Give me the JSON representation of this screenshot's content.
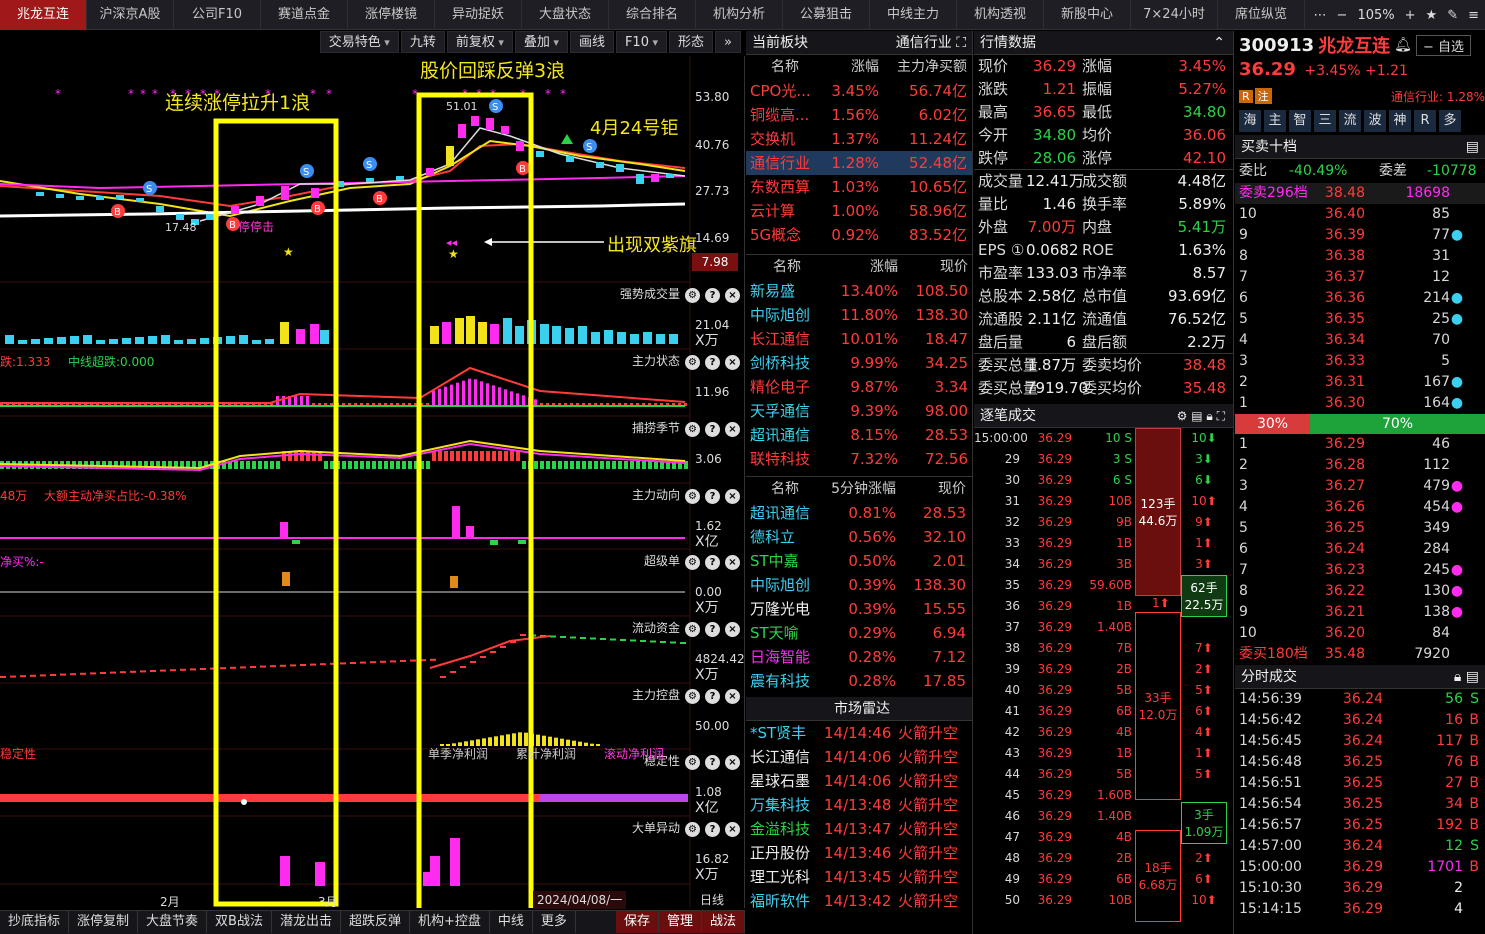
{
  "tabs": [
    "兆龙互连",
    "沪深京A股",
    "公司F10",
    "赛道点金",
    "涨停楼镜",
    "异动捉妖",
    "大盘状态",
    "综合排名",
    "机构分析",
    "公募狙击",
    "中线主力",
    "机构透视",
    "新股中心",
    "7×24小时",
    "席位纵览"
  ],
  "tab_controls": {
    "zoom": "105%"
  },
  "chart_toolbar": [
    "交易特色",
    "九转",
    "前复权",
    "叠加",
    "画线",
    "F10",
    "形态"
  ],
  "annotations": {
    "wave1": "连续涨停拉升1浪",
    "wave3": "股价回踩反弹3浪",
    "date_note": "4月24号钜",
    "purple_flag": "出现双紫旗",
    "pre_limit": "停停击"
  },
  "price_axis": {
    "high_label": "51.01",
    "low_label": "17.48",
    "ticks": [
      "53.80",
      "40.76",
      "27.73",
      "14.69"
    ],
    "current": "7.98"
  },
  "indicators": [
    {
      "name": "强势成交量",
      "value": "21.04",
      "unit": "X万"
    },
    {
      "name": "主力状态",
      "value": "11.96",
      "unit": "",
      "text_left": "跌:1.333",
      "text_mid": "中线超跌:0.000"
    },
    {
      "name": "捕捞季节",
      "value": "3.06",
      "unit": ""
    },
    {
      "name": "主力动向",
      "value": "1.62",
      "unit": "X亿",
      "text_left": "48万",
      "text_mid": "大额主动净买占比:-0.38%"
    },
    {
      "name": "超级单",
      "value": "0.00",
      "unit": "X万",
      "text_left": "净买%:-"
    },
    {
      "name": "流动资金",
      "value": "4824.42",
      "unit": "X万"
    },
    {
      "name": "主力控盘",
      "value": "50.00",
      "unit": ""
    },
    {
      "name": "稳定性",
      "value": "1.08",
      "unit": "X亿",
      "legend": [
        "单季净利润",
        "累计净利润",
        "滚动净利润"
      ]
    },
    {
      "name": "大单异动",
      "value": "16.82",
      "unit": "X万"
    }
  ],
  "x_axis": {
    "feb": "2月",
    "mar": "3月",
    "cursor_date": "2024/04/08/一",
    "period": "日线"
  },
  "bottom_bar": [
    "抄底指标",
    "涨停复制",
    "大盘节奏",
    "双B战法",
    "潜龙出击",
    "超跌反弹",
    "机构+控盘",
    "中线",
    "更多"
  ],
  "bottom_right": [
    "保存",
    "管理",
    "战法"
  ],
  "sector": {
    "header": "当前板块",
    "industry": "通信行业",
    "cols": [
      "名称",
      "涨幅",
      "主力净买额"
    ],
    "rows": [
      [
        "CPO光...",
        "3.45%",
        "56.74亿"
      ],
      [
        "铜缆高...",
        "1.56%",
        "6.02亿"
      ],
      [
        "交换机",
        "1.37%",
        "11.24亿"
      ],
      [
        "通信行业",
        "1.28%",
        "52.48亿"
      ],
      [
        "东数西算",
        "1.03%",
        "10.65亿"
      ],
      [
        "云计算",
        "1.00%",
        "58.96亿"
      ],
      [
        "5G概念",
        "0.92%",
        "83.52亿"
      ]
    ]
  },
  "gainers": {
    "cols": [
      "名称",
      "涨幅",
      "现价"
    ],
    "rows": [
      [
        "新易盛",
        "13.40%",
        "108.50"
      ],
      [
        "中际旭创",
        "11.80%",
        "138.30"
      ],
      [
        "长江通信",
        "10.01%",
        "18.47"
      ],
      [
        "剑桥科技",
        "9.99%",
        "34.25"
      ],
      [
        "精伦电子",
        "9.87%",
        "3.34"
      ],
      [
        "天孚通信",
        "9.39%",
        "98.00"
      ],
      [
        "超讯通信",
        "8.15%",
        "28.53"
      ],
      [
        "联特科技",
        "7.32%",
        "72.56"
      ]
    ]
  },
  "speed5": {
    "cols": [
      "名称",
      "5分钟涨幅",
      "现价"
    ],
    "rows": [
      [
        "超讯通信",
        "0.81%",
        "28.53"
      ],
      [
        "德科立",
        "0.56%",
        "32.10"
      ],
      [
        "ST中嘉",
        "0.50%",
        "2.01"
      ],
      [
        "中际旭创",
        "0.39%",
        "138.30"
      ],
      [
        "万隆光电",
        "0.39%",
        "15.55"
      ],
      [
        "ST天喻",
        "0.29%",
        "6.94"
      ],
      [
        "日海智能",
        "0.28%",
        "7.12"
      ],
      [
        "震有科技",
        "0.28%",
        "17.85"
      ]
    ]
  },
  "radar": {
    "header": "市场雷达",
    "rows": [
      [
        "*ST贤丰",
        "14/14:46",
        "火箭升空"
      ],
      [
        "长江通信",
        "14/14:06",
        "火箭升空"
      ],
      [
        "星球石墨",
        "14/14:06",
        "火箭升空"
      ],
      [
        "万集科技",
        "14/13:48",
        "火箭升空"
      ],
      [
        "金溢科技",
        "14/13:47",
        "火箭升空"
      ],
      [
        "正丹股份",
        "14/13:46",
        "火箭升空"
      ],
      [
        "理工光科",
        "14/13:45",
        "火箭升空"
      ],
      [
        "福昕软件",
        "14/13:42",
        "火箭升空"
      ]
    ]
  },
  "quote": {
    "header": "行情数据",
    "rows": [
      [
        "现价",
        "36.29",
        "涨幅",
        "3.45%"
      ],
      [
        "涨跌",
        "1.21",
        "振幅",
        "5.27%"
      ],
      [
        "最高",
        "36.65",
        "最低",
        "34.80"
      ],
      [
        "今开",
        "34.80",
        "均价",
        "36.06"
      ],
      [
        "跌停",
        "28.06",
        "涨停",
        "42.10"
      ],
      [
        "成交量",
        "12.41万",
        "成交额",
        "4.48亿"
      ],
      [
        "量比",
        "1.46",
        "换手率",
        "5.89%"
      ],
      [
        "外盘",
        "7.00万",
        "内盘",
        "5.41万"
      ],
      [
        "EPS ①",
        "0.0682",
        "ROE",
        "1.63%"
      ],
      [
        "市盈率",
        "133.03",
        "市净率",
        "8.57"
      ],
      [
        "总股本",
        "2.58亿",
        "总市值",
        "93.69亿"
      ],
      [
        "流通股",
        "2.11亿",
        "流通值",
        "76.52亿"
      ],
      [
        "盘后量",
        "6",
        "盘后额",
        "2.2万"
      ],
      [
        "委买总量",
        "1.87万",
        "委卖均价",
        "38.48"
      ],
      [
        "委买总量",
        "7919.70",
        "委买均价",
        "35.48"
      ]
    ]
  },
  "ticks": {
    "header": "逐笔成交",
    "first_time": "15:00:00",
    "times": [
      "",
      "29",
      "30",
      "31",
      "32",
      "33",
      "34",
      "35",
      "36",
      "37",
      "38",
      "39",
      "40",
      "41",
      "42",
      "43",
      "44",
      "45",
      "46",
      "47",
      "48",
      "49",
      "50"
    ],
    "prices": [
      "36.29",
      "36.29",
      "36.29",
      "36.29",
      "36.29",
      "36.29",
      "36.29",
      "36.29",
      "36.29",
      "36.29",
      "36.29",
      "36.29",
      "36.29",
      "36.29",
      "36.29",
      "36.29",
      "36.29",
      "36.29",
      "36.29",
      "36.29",
      "36.29",
      "36.29",
      "36.29"
    ],
    "vols": [
      "10 S",
      "3 S",
      "6 S",
      "10B",
      "9B",
      "1B",
      "3B",
      "59.60B",
      "1B",
      "1.40B",
      "7B",
      "2B",
      "5B",
      "6B",
      "4B",
      "1B",
      "5B",
      "1.60B",
      "1.40B",
      "4B",
      "2B",
      "6B",
      "10B"
    ],
    "right": [
      "10⬇",
      "3⬇",
      "6⬇",
      "10⬆",
      "9⬆",
      "1⬆",
      "3⬆",
      "",
      "",
      "",
      "7⬆",
      "2⬆",
      "5⬆",
      "6⬆",
      "4⬆",
      "1⬆",
      "5⬆",
      "",
      "",
      "4⬆",
      "2⬆",
      "6⬆",
      "10⬆"
    ],
    "blocks": [
      {
        "a": "123手",
        "b": "44.6万"
      },
      {
        "a": "62手",
        "b": "22.5万"
      },
      {
        "a": "33手",
        "b": "12.0万"
      },
      {
        "a": "3手",
        "b": "1.09万"
      },
      {
        "a": "18手",
        "b": "6.68万"
      }
    ],
    "mark_1up": "1⬆"
  },
  "stock": {
    "code": "300913",
    "name": "兆龙互连",
    "price": "36.29",
    "change": "+3.45% +1.21",
    "watch": "自选",
    "tag_r": "R",
    "tag_zhu": "注",
    "industry": "通信行业: 1.28%",
    "quick": [
      "海",
      "主",
      "智",
      "三",
      "流",
      "波",
      "神",
      "R",
      "多"
    ]
  },
  "book": {
    "header": "买卖十档",
    "weibi_label": "委比",
    "weibi": "-40.49%",
    "weicha_label": "委差",
    "weicha": "-10778",
    "ask_total": [
      "委卖296档",
      "38.48",
      "18698"
    ],
    "asks": [
      [
        "10",
        "36.40",
        "85"
      ],
      [
        "9",
        "36.39",
        "77"
      ],
      [
        "8",
        "36.38",
        "31"
      ],
      [
        "7",
        "36.37",
        "12"
      ],
      [
        "6",
        "36.36",
        "214"
      ],
      [
        "5",
        "36.35",
        "25"
      ],
      [
        "4",
        "36.34",
        "70"
      ],
      [
        "3",
        "36.33",
        "5"
      ],
      [
        "2",
        "36.31",
        "167"
      ],
      [
        "1",
        "36.30",
        "164"
      ]
    ],
    "ratio": {
      "sell": "30%",
      "buy": "70%",
      "sell_frac": 0.3
    },
    "bids": [
      [
        "1",
        "36.29",
        "46"
      ],
      [
        "2",
        "36.28",
        "112"
      ],
      [
        "3",
        "36.27",
        "479"
      ],
      [
        "4",
        "36.26",
        "454"
      ],
      [
        "5",
        "36.25",
        "349"
      ],
      [
        "6",
        "36.24",
        "284"
      ],
      [
        "7",
        "36.23",
        "245"
      ],
      [
        "8",
        "36.22",
        "130"
      ],
      [
        "9",
        "36.21",
        "138"
      ],
      [
        "10",
        "36.20",
        "84"
      ]
    ],
    "bid_total": [
      "委买180档",
      "35.48",
      "7920"
    ]
  },
  "fenshi": {
    "header": "分时成交",
    "rows": [
      [
        "14:56:39",
        "36.24",
        "56",
        "S"
      ],
      [
        "14:56:42",
        "36.24",
        "16",
        "B"
      ],
      [
        "14:56:45",
        "36.24",
        "117",
        "B"
      ],
      [
        "14:56:48",
        "36.25",
        "76",
        "B"
      ],
      [
        "14:56:51",
        "36.25",
        "27",
        "B"
      ],
      [
        "14:56:54",
        "36.25",
        "34",
        "B"
      ],
      [
        "14:56:57",
        "36.25",
        "192",
        "B"
      ],
      [
        "14:57:00",
        "36.24",
        "12",
        "S"
      ],
      [
        "15:00:00",
        "36.29",
        "1701",
        "B"
      ],
      [
        "15:10:30",
        "36.29",
        "2",
        ""
      ],
      [
        "15:14:15",
        "36.29",
        "4",
        ""
      ]
    ]
  },
  "colors": {
    "up": "#ff3b3b",
    "down": "#2bd34a",
    "highlight_box": "#ffff00",
    "magenta": "#ff2cf0",
    "cyan": "#3bd0f0"
  }
}
